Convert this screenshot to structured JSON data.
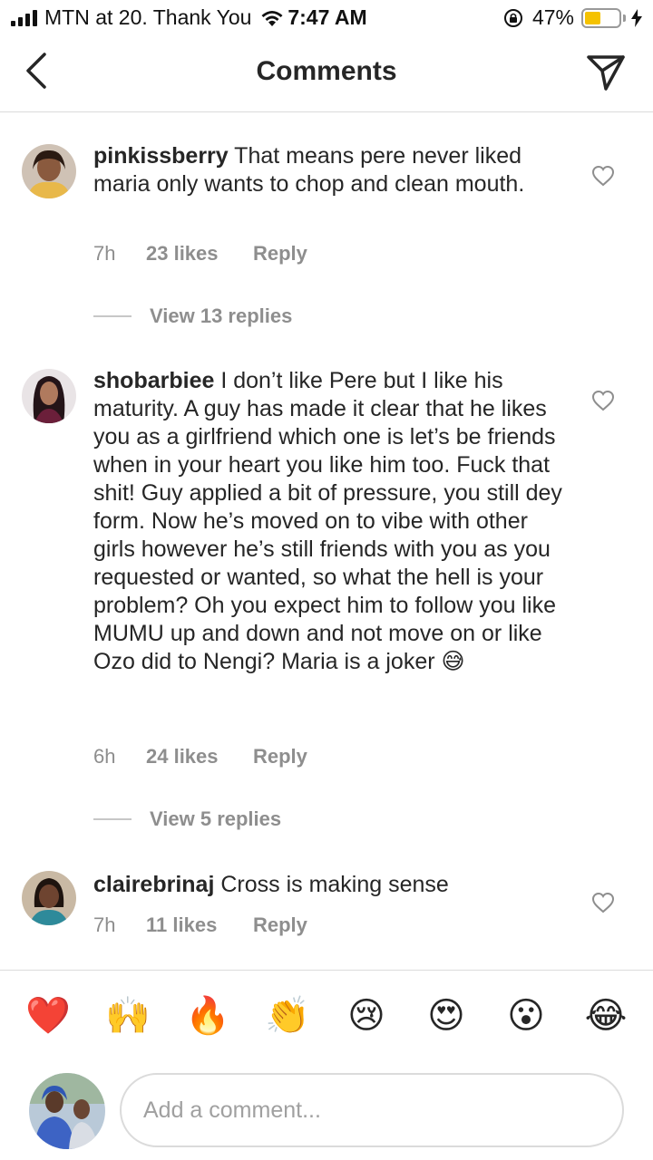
{
  "status_bar": {
    "carrier": "MTN at 20. Thank You",
    "time": "7:47 AM",
    "battery_percent": "47%",
    "battery_level": 0.47
  },
  "header": {
    "title": "Comments"
  },
  "comments": [
    {
      "username": "pinkissberry",
      "text": " That means pere never liked maria only wants to chop and clean mouth.",
      "time": "7h",
      "likes": "23 likes",
      "reply_label": "Reply",
      "view_replies": "View 13 replies"
    },
    {
      "username": "shobarbiee",
      "text": " I don’t like Pere but I like his maturity. A guy has made it clear that he likes you as a girlfriend which one is let’s be friends when in your heart you like him too. Fuck that shit! Guy applied a bit of pressure, you still dey form. Now he’s moved on to vibe with other girls however he’s still friends with you as you requested or wanted, so what the hell is your problem? Oh you expect him to follow you like MUMU up and down and not move on or like Ozo did to Nengi? Maria is a joker 😅",
      "time": "6h",
      "likes": "24 likes",
      "reply_label": "Reply",
      "view_replies": "View 5 replies"
    },
    {
      "username": "clairebrinaj",
      "text": " Cross is making sense",
      "time": "7h",
      "likes": "11 likes",
      "reply_label": "Reply"
    }
  ],
  "emoji_bar": [
    "❤️",
    "🙌",
    "🔥",
    "👏",
    "😢",
    "😍",
    "😮",
    "😂"
  ],
  "composer": {
    "placeholder": "Add a comment..."
  },
  "colors": {
    "text": "#262626",
    "secondary": "#8e8e8e",
    "divider": "#dbdbdb",
    "battery": "#f5c200"
  }
}
